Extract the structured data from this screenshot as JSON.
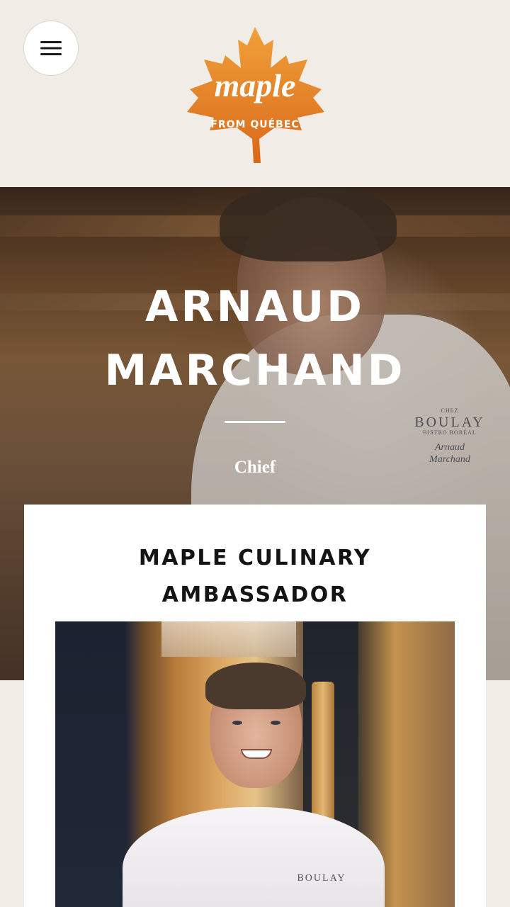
{
  "header": {
    "menu_icon": "hamburger-menu-icon",
    "logo": {
      "wordmark": "maple",
      "subtitle": "FROM QUÉBEC",
      "brand_color": "#e07a1c"
    }
  },
  "hero": {
    "name_line1": "ARNAUD",
    "name_line2": "MARCHAND",
    "role": "Chief",
    "coat_embroidery": {
      "small_top": "CHEZ",
      "restaurant": "BOULAY",
      "tagline": "BISTRO BORÉAL",
      "script_line1": "Arnaud",
      "script_line2": "Marchand"
    }
  },
  "card": {
    "title_line1": "MAPLE CULINARY",
    "title_line2": "AMBASSADOR",
    "portrait_embroidery": "BOULAY"
  },
  "colors": {
    "page_background": "#f1ede6",
    "card_background": "#ffffff",
    "text_dark": "#141414",
    "hero_text": "#ffffff"
  }
}
